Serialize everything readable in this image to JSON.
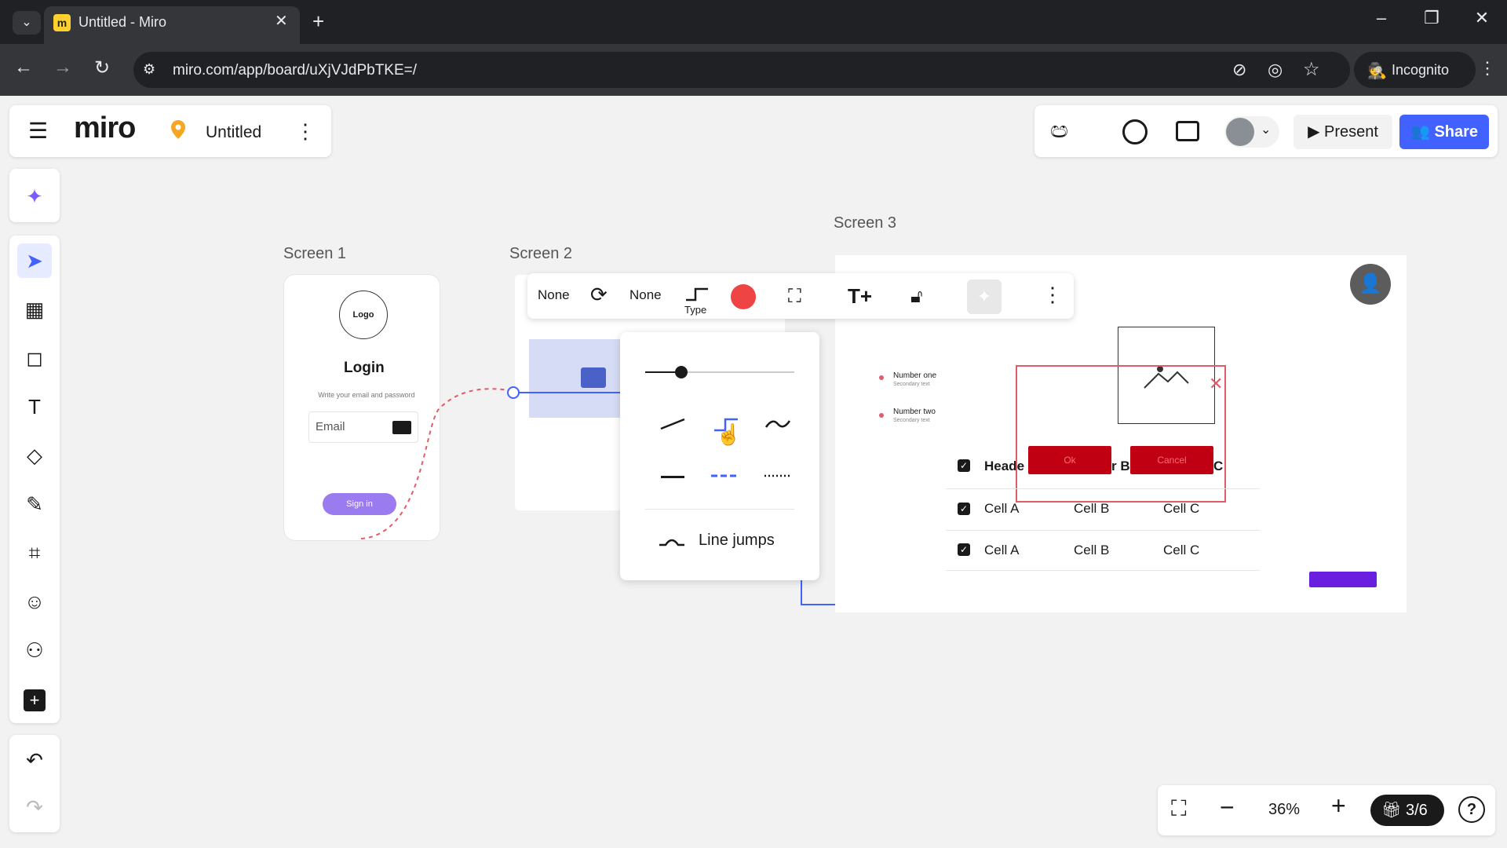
{
  "browser": {
    "tab_title": "Untitled - Miro",
    "tab_close": "✕",
    "new_tab": "+",
    "url": "miro.com/app/board/uXjVJdPbTKE=/",
    "incognito_label": "Incognito"
  },
  "board": {
    "logo": "miro",
    "title": "Untitled",
    "present_label": "Present",
    "share_label": "Share"
  },
  "frames": {
    "screen1_title": "Screen 1",
    "screen2_title": "Screen 2",
    "screen3_title": "Screen 3"
  },
  "screen1": {
    "logo_text": "Logo",
    "heading": "Login",
    "subtitle": "Write your email and password",
    "email_placeholder": "Email",
    "signin_label": "Sign in"
  },
  "context_toolbar": {
    "start_cap": "None",
    "end_cap": "None",
    "type_label": "Type",
    "line_color": "#ef4444"
  },
  "line_dropdown": {
    "line_jumps_label": "Line jumps"
  },
  "screen3": {
    "list": [
      {
        "title": "Number one",
        "sub": "Secondary text"
      },
      {
        "title": "Number two",
        "sub": "Secondary text"
      }
    ],
    "header_cell": "Heade",
    "header_mid": "r B",
    "header_c": "C",
    "ok_label": "Ok",
    "cancel_label": "Cancel",
    "rows": [
      {
        "a": "Cell A",
        "b": "Cell B",
        "c": "Cell C"
      },
      {
        "a": "Cell A",
        "b": "Cell B",
        "c": "Cell C"
      }
    ]
  },
  "bottom_bar": {
    "zoom": "36%",
    "pages": "3/6"
  }
}
